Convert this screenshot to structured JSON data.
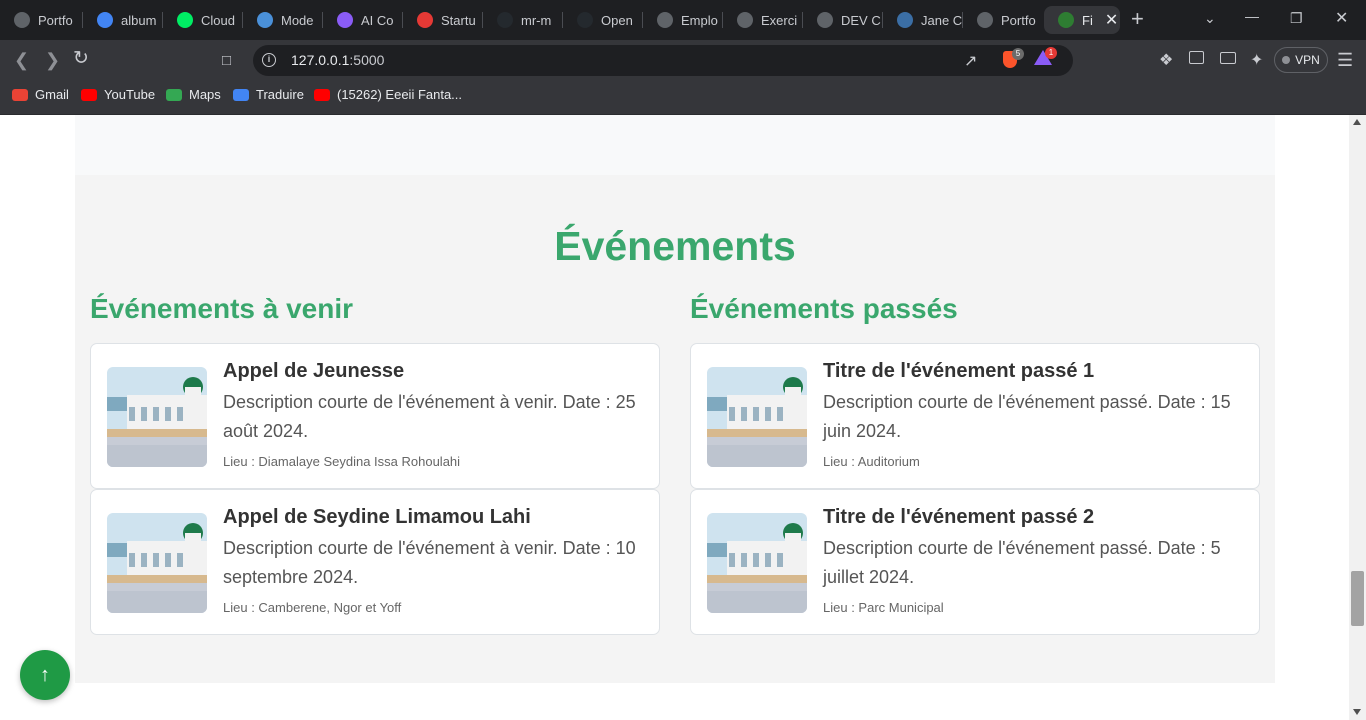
{
  "browser": {
    "tabs": [
      {
        "label": "Portfo",
        "icon": "portfolio-favicon",
        "color": "#5f6368"
      },
      {
        "label": "album",
        "icon": "google-favicon",
        "color": "#4285f4"
      },
      {
        "label": "Cloud",
        "icon": "mongodb-favicon",
        "color": "#00ed64"
      },
      {
        "label": "Mode",
        "icon": "document-favicon",
        "color": "#4a90d9"
      },
      {
        "label": "AI Co",
        "icon": "ai-favicon",
        "color": "#8a5cf6"
      },
      {
        "label": "Startu",
        "icon": "startup-favicon",
        "color": "#e53935"
      },
      {
        "label": "mr-m",
        "icon": "github-favicon",
        "color": "#24292e"
      },
      {
        "label": "Open",
        "icon": "github-favicon",
        "color": "#24292e"
      },
      {
        "label": "Emplo",
        "icon": "info-favicon",
        "color": "#5f6368"
      },
      {
        "label": "Exerci",
        "icon": "exercise-favicon",
        "color": "#5f6368"
      },
      {
        "label": "DEV C",
        "icon": "dev-favicon",
        "color": "#5f6368"
      },
      {
        "label": "Jane C",
        "icon": "jane-favicon",
        "color": "#3b6ea5"
      },
      {
        "label": "Portfo",
        "icon": "globe-favicon",
        "color": "#5f6368"
      },
      {
        "label": "Fi",
        "icon": "site-favicon",
        "color": "#2e7d32"
      }
    ],
    "url_host": "127.0.0.1",
    "url_port": ":5000",
    "brave_badge": "5",
    "rewards_badge": "1",
    "vpn_label": "VPN",
    "bookmarks": [
      {
        "label": "Gmail",
        "icon": "gmail-icon",
        "color": "#ea4335"
      },
      {
        "label": "YouTube",
        "icon": "youtube-icon",
        "color": "#ff0000"
      },
      {
        "label": "Maps",
        "icon": "maps-icon",
        "color": "#34a853"
      },
      {
        "label": "Traduire",
        "icon": "translate-icon",
        "color": "#4285f4"
      },
      {
        "label": "(15262) Eeeii Fanta...",
        "icon": "youtube-icon",
        "color": "#ff0000"
      }
    ]
  },
  "page": {
    "section_title": "Événements",
    "upcoming_title": "Événements à venir",
    "past_title": "Événements passés",
    "location_prefix": "Lieu : ",
    "upcoming": [
      {
        "title": "Appel de Jeunesse",
        "description": "Description courte de l'événement à venir. Date : 25 août 2024.",
        "location": "Diamalaye Seydina Issa Rohoulahi"
      },
      {
        "title": "Appel de Seydine Limamou Lahi",
        "description": "Description courte de l'événement à venir. Date : 10 septembre 2024.",
        "location": "Camberene, Ngor et Yoff"
      }
    ],
    "past": [
      {
        "title": "Titre de l'événement passé 1",
        "description": "Description courte de l'événement passé. Date : 15 juin 2024.",
        "location": "Auditorium"
      },
      {
        "title": "Titre de l'événement passé 2",
        "description": "Description courte de l'événement passé. Date : 5 juillet 2024.",
        "location": "Parc Municipal"
      }
    ],
    "accent_color": "#3aa76d",
    "scroll_top_color": "#1f9a45",
    "scroll_top_icon": "arrow-up-icon"
  }
}
